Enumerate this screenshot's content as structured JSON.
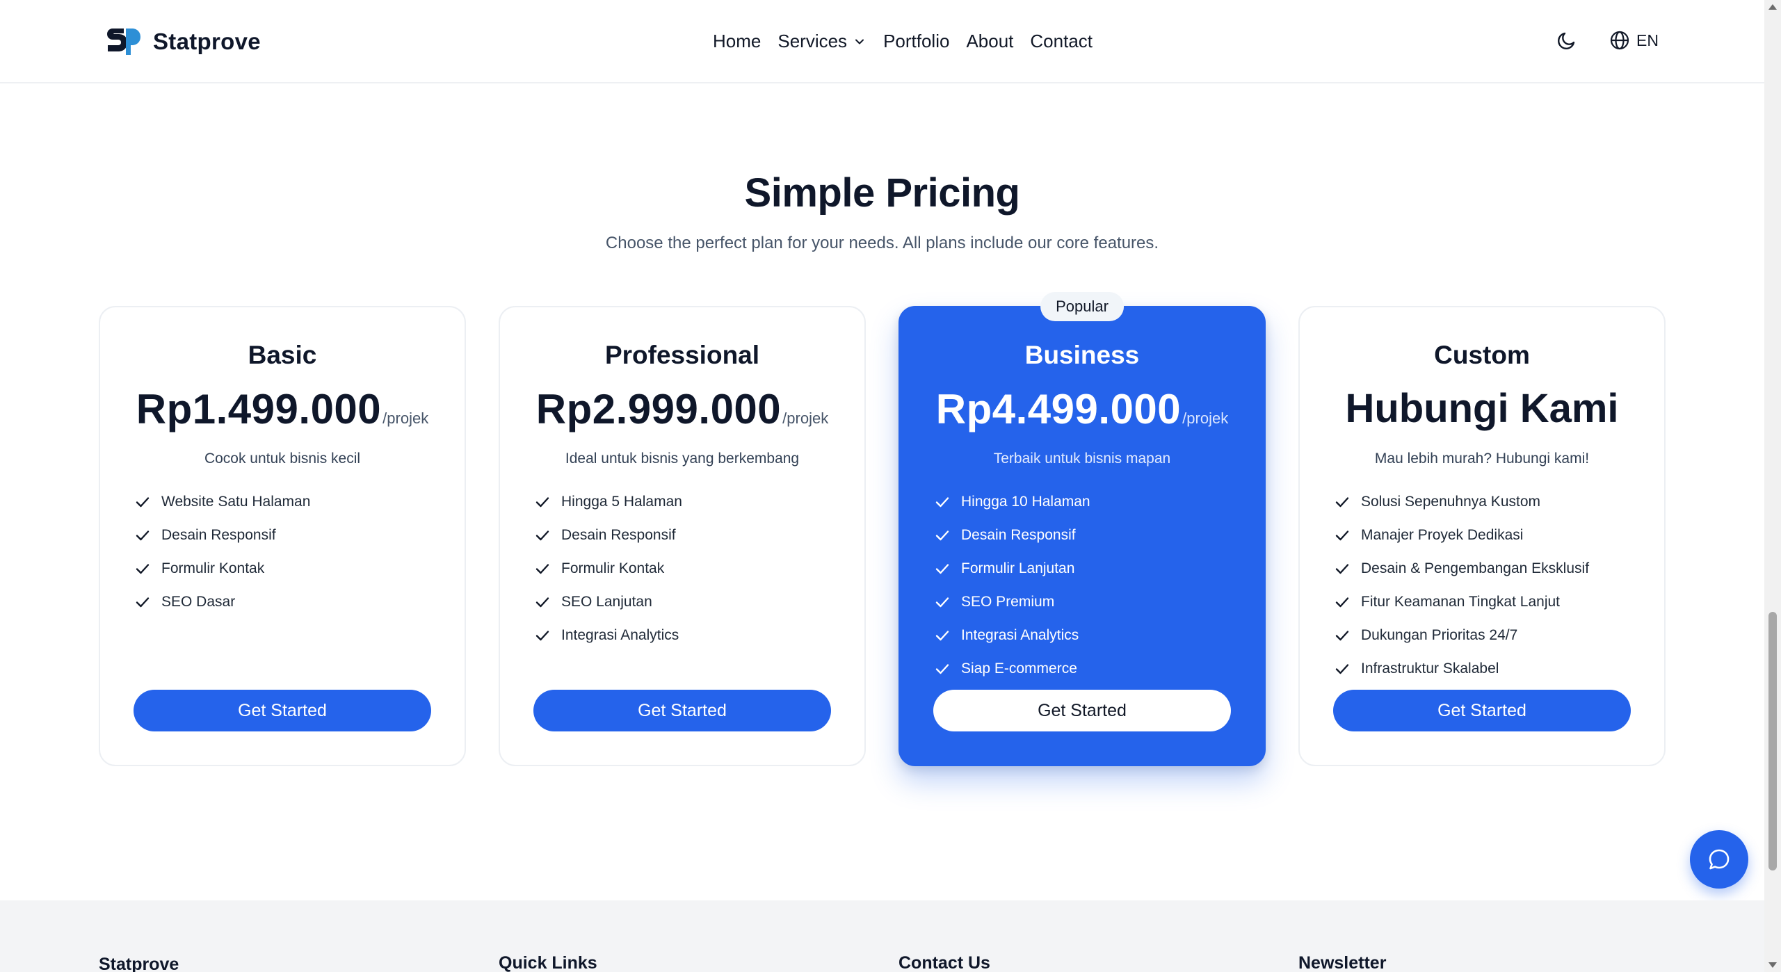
{
  "header": {
    "brand": "Statprove",
    "nav": [
      {
        "label": "Home"
      },
      {
        "label": "Services",
        "has_dropdown": true
      },
      {
        "label": "Portfolio"
      },
      {
        "label": "About"
      },
      {
        "label": "Contact"
      }
    ],
    "language": "EN",
    "icons": {
      "theme": "moon-icon",
      "language": "globe-icon"
    }
  },
  "pricing": {
    "title": "Simple Pricing",
    "subtitle": "Choose the perfect plan for your needs. All plans include our core features.",
    "plans": [
      {
        "name": "Basic",
        "price": "Rp1.499.000",
        "period": "/projek",
        "description": "Cocok untuk bisnis kecil",
        "features": [
          "Website Satu Halaman",
          "Desain Responsif",
          "Formulir Kontak",
          "SEO Dasar"
        ],
        "cta": "Get Started"
      },
      {
        "name": "Professional",
        "price": "Rp2.999.000",
        "period": "/projek",
        "description": "Ideal untuk bisnis yang berkembang",
        "features": [
          "Hingga 5 Halaman",
          "Desain Responsif",
          "Formulir Kontak",
          "SEO Lanjutan",
          "Integrasi Analytics"
        ],
        "cta": "Get Started"
      },
      {
        "name": "Business",
        "badge": "Popular",
        "price": "Rp4.499.000",
        "period": "/projek",
        "description": "Terbaik untuk bisnis mapan",
        "features": [
          "Hingga 10 Halaman",
          "Desain Responsif",
          "Formulir Lanjutan",
          "SEO Premium",
          "Integrasi Analytics",
          "Siap E-commerce"
        ],
        "cta": "Get Started"
      },
      {
        "name": "Custom",
        "price": "Hubungi Kami",
        "description": "Mau lebih murah? Hubungi kami!",
        "features": [
          "Solusi Sepenuhnya Kustom",
          "Manajer Proyek Dedikasi",
          "Desain & Pengembangan Eksklusif",
          "Fitur Keamanan Tingkat Lanjut",
          "Dukungan Prioritas 24/7",
          "Infrastruktur Skalabel"
        ],
        "cta": "Get Started"
      }
    ]
  },
  "footer": {
    "brand": "Statprove",
    "columns": [
      "Quick Links",
      "Contact Us",
      "Newsletter"
    ]
  },
  "colors": {
    "accent": "#2563eb",
    "text": "#0f172a",
    "muted": "#475569",
    "footer_bg": "#f3f4f6"
  }
}
